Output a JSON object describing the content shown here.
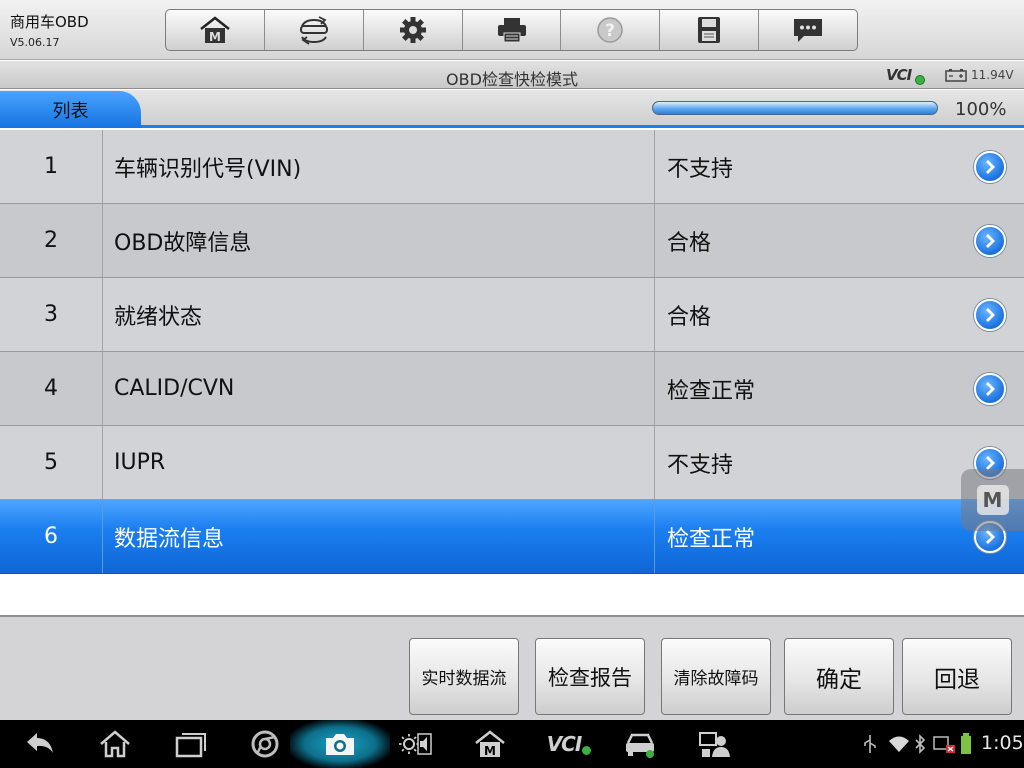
{
  "header": {
    "app_title": "商用车OBD",
    "version": "V5.06.17"
  },
  "toolbar": {
    "buttons": [
      {
        "name": "home-button",
        "icon": "m-home-icon"
      },
      {
        "name": "vehicle-swap-button",
        "icon": "car-swap-icon"
      },
      {
        "name": "settings-button",
        "icon": "gear-icon"
      },
      {
        "name": "print-button",
        "icon": "printer-icon"
      },
      {
        "name": "help-button",
        "icon": "help-icon"
      },
      {
        "name": "save-button",
        "icon": "floppy-icon"
      },
      {
        "name": "messages-button",
        "icon": "chat-icon"
      }
    ]
  },
  "titlebar": {
    "title": "OBD检查快检模式",
    "vci_label": "VCI",
    "voltage": "11.94V"
  },
  "tab": {
    "label": "列表",
    "progress_pct": 100,
    "progress_label": "100%"
  },
  "rows": [
    {
      "num": "1",
      "name": "车辆识别代号(VIN)",
      "status": "不支持"
    },
    {
      "num": "2",
      "name": "OBD故障信息",
      "status": "合格"
    },
    {
      "num": "3",
      "name": "就绪状态",
      "status": "合格"
    },
    {
      "num": "4",
      "name": "CALID/CVN",
      "status": "检查正常"
    },
    {
      "num": "5",
      "name": "IUPR",
      "status": "不支持"
    },
    {
      "num": "6",
      "name": "数据流信息",
      "status": "检查正常"
    }
  ],
  "selected_row": 6,
  "floating_button": {
    "label": "M"
  },
  "actions": {
    "live_data": "实时数据流",
    "check_report": "检查报告",
    "clear_codes": "清除故障码",
    "confirm": "确定",
    "back": "回退"
  },
  "system": {
    "clock": "1:05",
    "vci_label": "VCI"
  },
  "colors": {
    "accent_blue": "#1b7ff0",
    "row_odd": "#d2d3d7",
    "row_even": "#c8c9cc",
    "toolbar_bg": "#e6e6e6"
  }
}
